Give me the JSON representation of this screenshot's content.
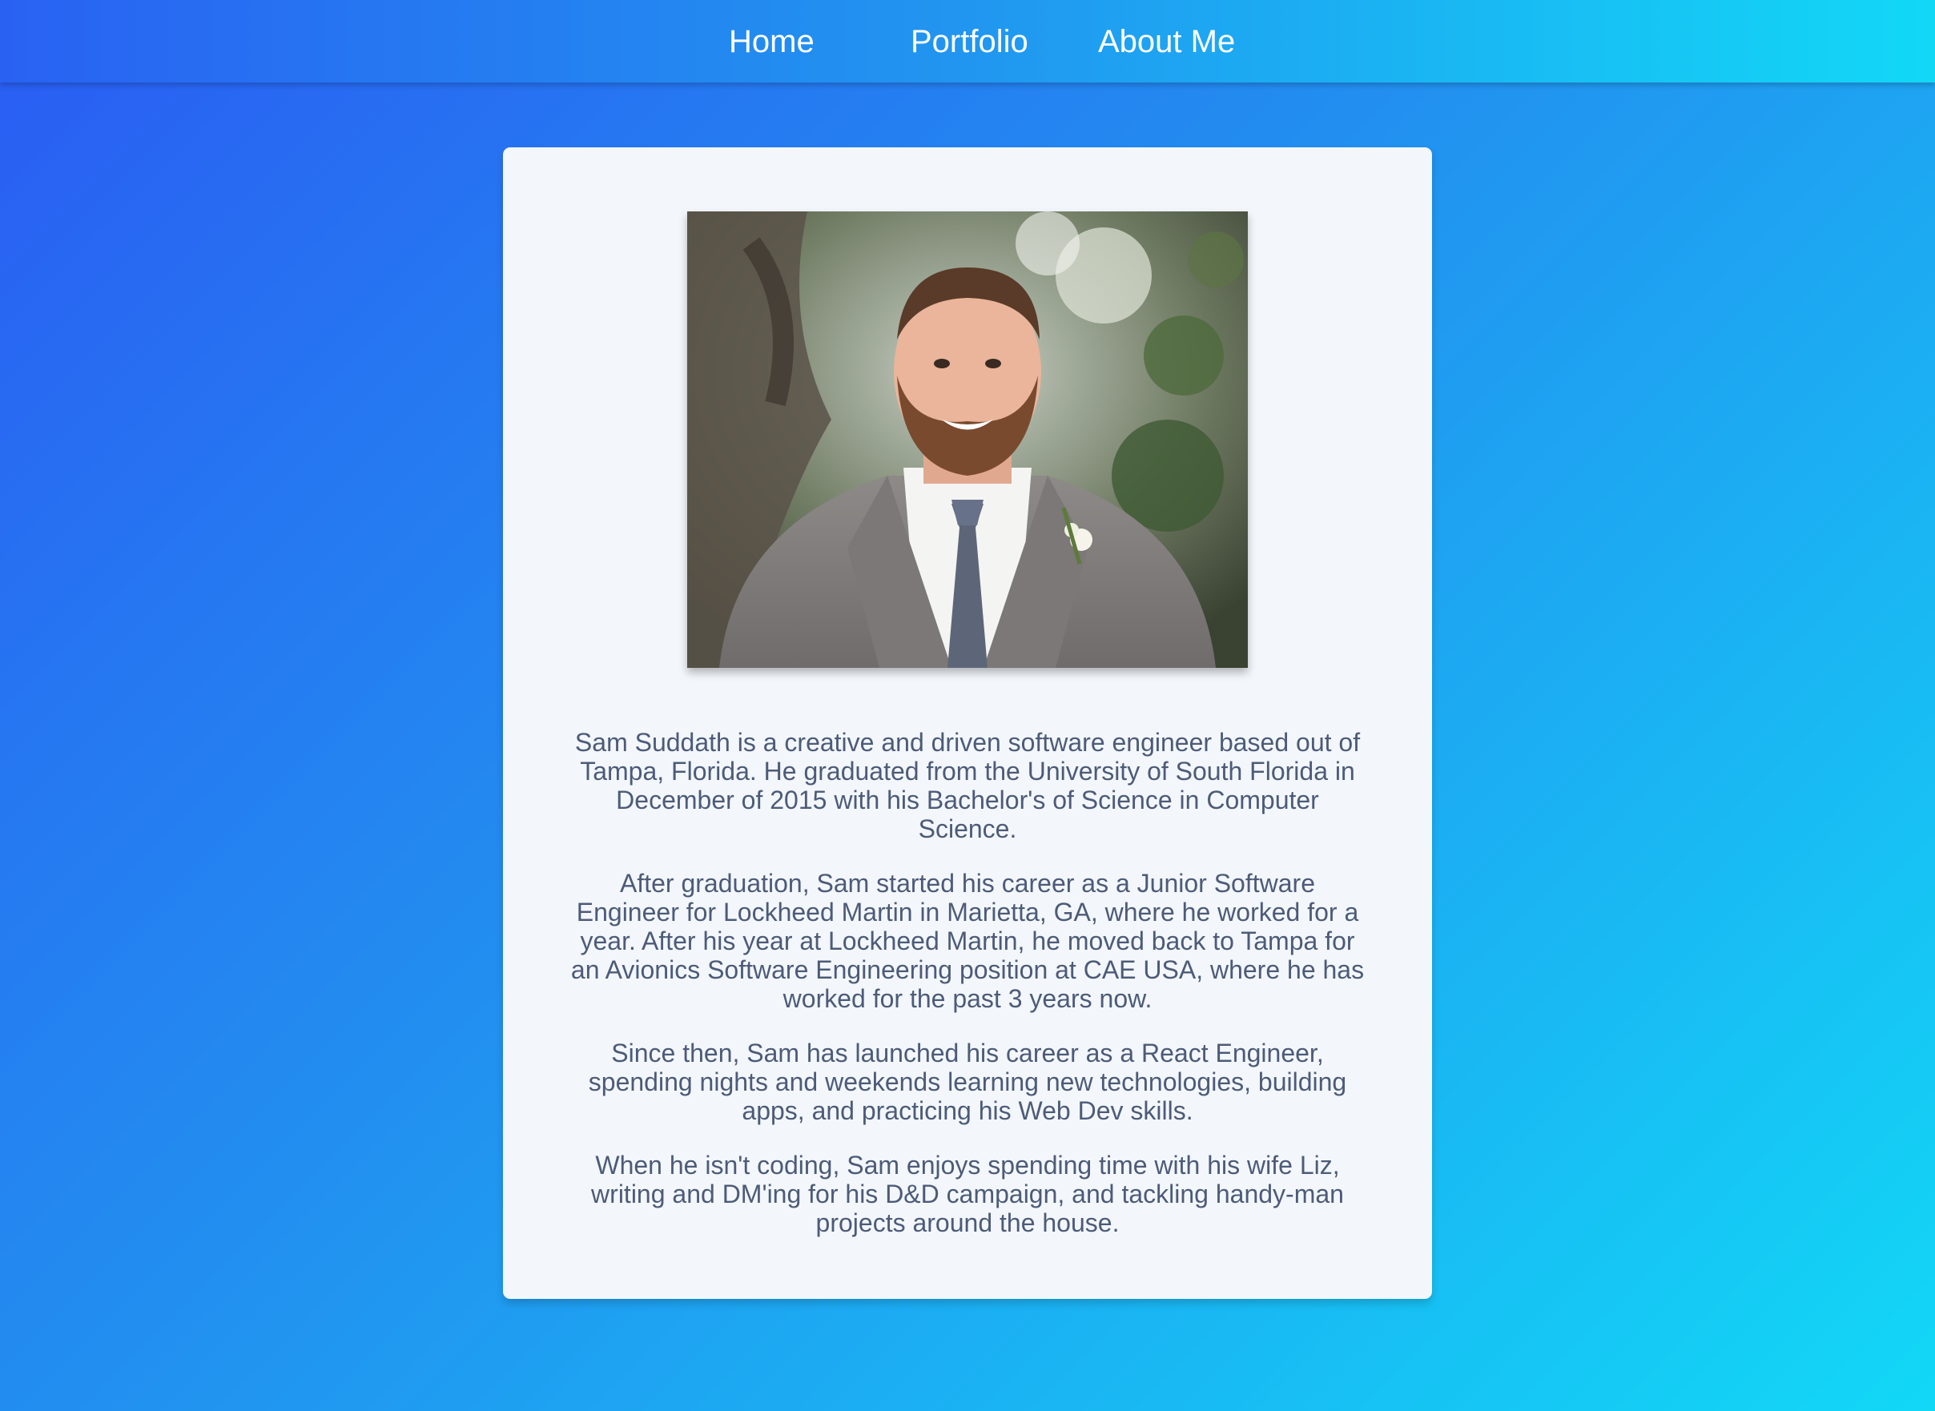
{
  "nav": {
    "home": "Home",
    "portfolio": "Portfolio",
    "about": "About Me"
  },
  "profile": {
    "photo_alt": "Portrait of Sam Suddath in a grey suit"
  },
  "bio": {
    "paragraphs": [
      "Sam Suddath is a creative and driven software engineer based out of Tampa, Florida. He graduated from the University of South Florida in December of 2015 with his Bachelor's of Science in Computer Science.",
      "After graduation, Sam started his career as a Junior Software Engineer for Lockheed Martin in Marietta, GA, where he worked for a year. After his year at Lockheed Martin, he moved back to Tampa for an Avionics Software Engineering position at CAE USA, where he has worked for the past 3 years now.",
      "Since then, Sam has launched his career as a React Engineer, spending nights and weekends learning new technologies, building apps, and practicing his Web Dev skills.",
      "When he isn't coding, Sam enjoys spending time with his wife Liz, writing and DM'ing for his D&D campaign, and tackling handy-man projects around the house."
    ]
  },
  "colors": {
    "gradient_start": "#2a5cf3",
    "gradient_end": "#12d8f6",
    "card_background": "#f3f7fc",
    "body_text": "#4d5b78",
    "nav_text": "#ffffff"
  }
}
